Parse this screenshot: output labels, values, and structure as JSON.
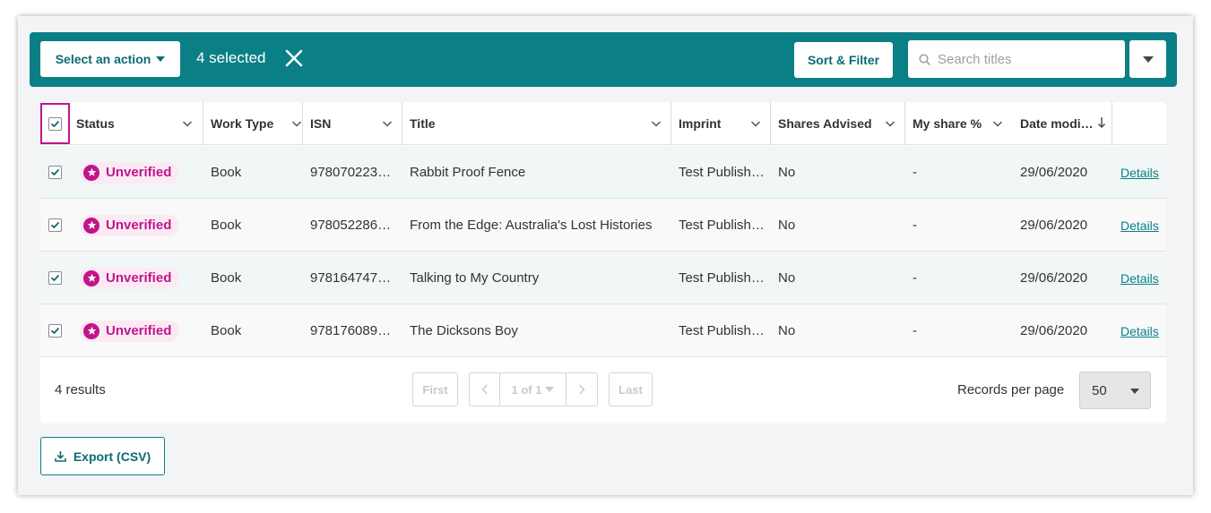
{
  "toolbar": {
    "action_label": "Select an action",
    "selected_text": "4 selected",
    "sort_filter_label": "Sort & Filter",
    "search_placeholder": "Search titles"
  },
  "table": {
    "columns": [
      "Status",
      "Work Type",
      "ISN",
      "Title",
      "Imprint",
      "Shares Advised",
      "My share %",
      "Date modi…"
    ],
    "rows": [
      {
        "status": "Unverified",
        "work_type": "Book",
        "isn": "978070223…",
        "title": "Rabbit Proof Fence",
        "imprint": "Test Publish…",
        "shares_advised": "No",
        "my_share": "-",
        "date_modified": "29/06/2020",
        "link": "Details"
      },
      {
        "status": "Unverified",
        "work_type": "Book",
        "isn": "978052286…",
        "title": "From the Edge: Australia's Lost Histories",
        "imprint": "Test Publish…",
        "shares_advised": "No",
        "my_share": "-",
        "date_modified": "29/06/2020",
        "link": "Details"
      },
      {
        "status": "Unverified",
        "work_type": "Book",
        "isn": "978164747…",
        "title": "Talking to My Country",
        "imprint": "Test Publish…",
        "shares_advised": "No",
        "my_share": "-",
        "date_modified": "29/06/2020",
        "link": "Details"
      },
      {
        "status": "Unverified",
        "work_type": "Book",
        "isn": "978176089…",
        "title": "The Dicksons Boy",
        "imprint": "Test Publish…",
        "shares_advised": "No",
        "my_share": "-",
        "date_modified": "29/06/2020",
        "link": "Details"
      }
    ]
  },
  "footer": {
    "results_text": "4 results",
    "first_label": "First",
    "page_label": "1 of 1",
    "last_label": "Last",
    "records_per_page_label": "Records per page",
    "records_per_page_value": "50"
  },
  "export_label": "Export (CSV)",
  "colors": {
    "brand_teal": "#0a7f86",
    "status_magenta": "#c0168c"
  }
}
